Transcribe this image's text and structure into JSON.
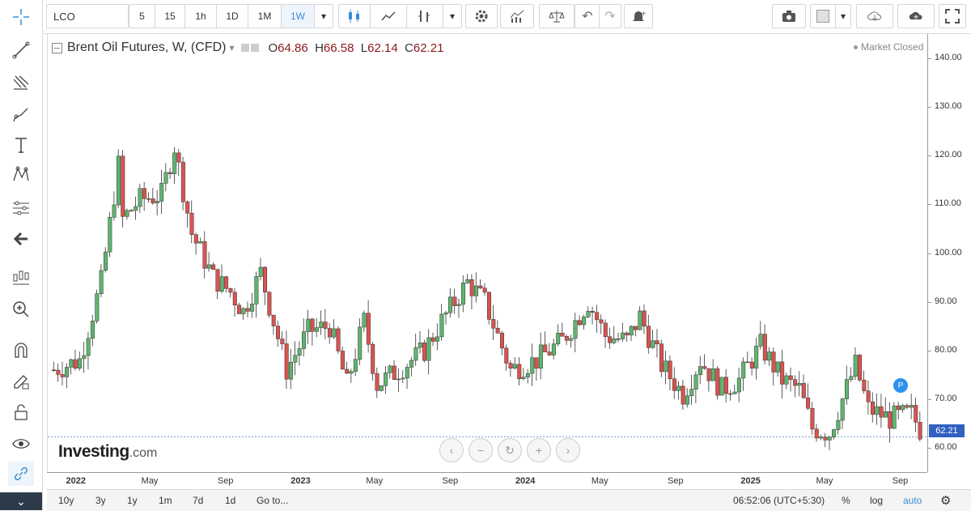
{
  "toolbar": {
    "symbol": "LCO",
    "intervals": [
      "5",
      "15",
      "1h",
      "1D",
      "1M",
      "1W"
    ],
    "active_interval": "1W"
  },
  "legend": {
    "title": "Brent Oil Futures, W, (CFD)",
    "open_label": "O",
    "open": "64.86",
    "high_label": "H",
    "high": "66.58",
    "low_label": "L",
    "low": "62.14",
    "close_label": "C",
    "close": "62.21"
  },
  "status": "Market Closed",
  "price_badge": "62.21",
  "logo": {
    "main": "Investing",
    "domain": ".com"
  },
  "marker": "P",
  "bottom": {
    "ranges": [
      "10y",
      "3y",
      "1y",
      "1m",
      "7d",
      "1d"
    ],
    "goto": "Go to...",
    "time": "06:52:06 (UTC+5:30)",
    "percent": "%",
    "log": "log",
    "auto": "auto"
  },
  "colors": {
    "up": "#5fb56e",
    "down": "#d9534f",
    "accent": "#3a8ed8",
    "badge": "#3060c0"
  },
  "chart_data": {
    "type": "candlestick",
    "title": "Brent Oil Futures, W, (CFD)",
    "y_ticks": [
      "60.00",
      "70.00",
      "80.00",
      "90.00",
      "100.00",
      "110.00",
      "120.00",
      "130.00",
      "140.00"
    ],
    "ylim": [
      55,
      145
    ],
    "x_ticks": [
      "2022",
      "May",
      "Sep",
      "2023",
      "May",
      "Sep",
      "2024",
      "May",
      "Sep",
      "2025",
      "May",
      "Sep"
    ],
    "x_tick_dates": [
      "2022-01-01",
      "2022-05-01",
      "2022-09-01",
      "2023-01-01",
      "2023-05-01",
      "2023-09-01",
      "2024-01-01",
      "2024-05-01",
      "2024-09-01",
      "2025-01-01",
      "2025-05-01",
      "2025-09-01"
    ],
    "x_range": [
      "2021-11-15",
      "2025-10-15"
    ],
    "series_close": [
      {
        "date": "2021-11-22",
        "value": 76
      },
      {
        "date": "2022-01-03",
        "value": 78
      },
      {
        "date": "2022-02-07",
        "value": 94
      },
      {
        "date": "2022-03-07",
        "value": 118
      },
      {
        "date": "2022-03-14",
        "value": 107
      },
      {
        "date": "2022-04-11",
        "value": 111
      },
      {
        "date": "2022-05-16",
        "value": 112
      },
      {
        "date": "2022-06-06",
        "value": 122
      },
      {
        "date": "2022-07-04",
        "value": 104
      },
      {
        "date": "2022-08-08",
        "value": 95
      },
      {
        "date": "2022-09-05",
        "value": 92
      },
      {
        "date": "2022-09-26",
        "value": 88
      },
      {
        "date": "2022-10-24",
        "value": 96
      },
      {
        "date": "2022-12-05",
        "value": 76
      },
      {
        "date": "2023-01-09",
        "value": 84
      },
      {
        "date": "2023-02-13",
        "value": 85
      },
      {
        "date": "2023-03-13",
        "value": 73
      },
      {
        "date": "2023-04-10",
        "value": 86
      },
      {
        "date": "2023-05-01",
        "value": 73
      },
      {
        "date": "2023-06-05",
        "value": 76
      },
      {
        "date": "2023-07-17",
        "value": 80
      },
      {
        "date": "2023-08-14",
        "value": 86
      },
      {
        "date": "2023-09-25",
        "value": 94
      },
      {
        "date": "2023-10-23",
        "value": 90
      },
      {
        "date": "2023-12-04",
        "value": 76
      },
      {
        "date": "2024-01-15",
        "value": 78
      },
      {
        "date": "2024-02-26",
        "value": 82
      },
      {
        "date": "2024-04-08",
        "value": 90
      },
      {
        "date": "2024-05-06",
        "value": 83
      },
      {
        "date": "2024-06-10",
        "value": 82
      },
      {
        "date": "2024-07-01",
        "value": 87
      },
      {
        "date": "2024-08-05",
        "value": 77
      },
      {
        "date": "2024-09-09",
        "value": 71
      },
      {
        "date": "2024-10-07",
        "value": 78
      },
      {
        "date": "2024-11-11",
        "value": 72
      },
      {
        "date": "2024-12-09",
        "value": 74
      },
      {
        "date": "2025-01-13",
        "value": 81
      },
      {
        "date": "2025-02-17",
        "value": 74
      },
      {
        "date": "2025-03-17",
        "value": 72
      },
      {
        "date": "2025-04-07",
        "value": 64
      },
      {
        "date": "2025-05-05",
        "value": 63
      },
      {
        "date": "2025-06-16",
        "value": 77
      },
      {
        "date": "2025-07-07",
        "value": 68
      },
      {
        "date": "2025-08-11",
        "value": 66
      },
      {
        "date": "2025-09-15",
        "value": 67
      },
      {
        "date": "2025-10-06",
        "value": 62.21
      }
    ]
  }
}
